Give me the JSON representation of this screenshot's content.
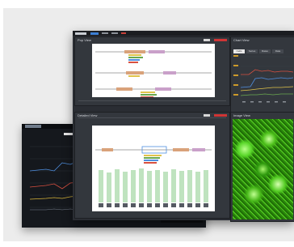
{
  "window_main": {
    "panel_top_left_title": "Pop View",
    "panel_bottom_left_title": "Detailed View",
    "panel_top_right_title": "Chart View",
    "panel_bottom_right_title": "Image View",
    "tabs": [
      "Cells",
      "Series",
      "Rates",
      "Data"
    ]
  },
  "colors": {
    "accent_blue": "#3d7fd4",
    "close_red": "#d03535",
    "dark_bg": "#2a2d33",
    "image_green": "#3fae16"
  }
}
